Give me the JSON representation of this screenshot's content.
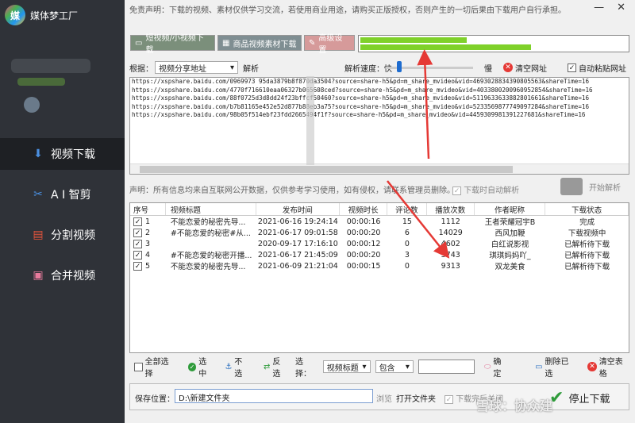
{
  "app": {
    "title": "媒体梦工厂",
    "logo_text": "媒"
  },
  "sidebar": {
    "items": [
      {
        "label": "视频下载",
        "icon": "download-icon"
      },
      {
        "label": "A I 智剪",
        "icon": "ai-icon"
      },
      {
        "label": "分割视频",
        "icon": "split-icon"
      },
      {
        "label": "合并视频",
        "icon": "merge-icon"
      }
    ]
  },
  "window": {
    "min": "—",
    "close": "✕"
  },
  "notice": "免责声明：下载的视频、素材仅供学习交流，若使用商业用途，请购买正版授权，否则产生的一切后果由下载用户自行承担。",
  "toolbar": {
    "btn1": "短视频/小视频下载",
    "btn2": "商品视频素材下载",
    "btn3": "高级设置",
    "progress": [
      0.4,
      0.64
    ]
  },
  "controls": {
    "by_label": "根据：",
    "by_value": "视频分享地址",
    "parse_label": "解析",
    "speed_label": "解析速度：",
    "fast": "快",
    "slow": "慢",
    "clear_url": "清空网址",
    "auto_paste": "自动粘贴网址"
  },
  "urls": [
    "https://xspshare.baidu.com/0969973 95da3879b8f870da3504?source=share-h5&pd=m_share_mvideo&vid=4693028834390805563&shareTime=16",
    "https://xspshare.baidu.com/4770f716610eaa06327b065608ced?source=share-h5&pd=m_share_mvideo&vid=4033800200960952854&shareTime=16",
    "https://xspshare.baidu.com/88f0725d3d8dd24f23bffcf50460?source=share-h5&pd=m_share_mvideo&vid=5119633633882801661&shareTime=16",
    "https://xspshare.baidu.com/b7b81165e452e52d877b88eb3a75?source=share-h5&pd=m_share_mvideo&vid=5233569877749097284&shareTime=16",
    "https://xspshare.baidu.com/98b05f514ebf23fdd2665494f1f?source=share-h5&pd=m_share_mvideo&vid=4459309981391227681&shareTime=16"
  ],
  "notice2": "声明：所有信息均来自互联网公开数据，仅供参考学习使用，如有侵权，请联系管理员删除。",
  "auto_parse": "下载时自动解析",
  "start_parse": "开始解析",
  "table": {
    "headers": [
      "序号",
      "视频标题",
      "发布时间",
      "视频时长",
      "评论数",
      "播放次数",
      "作者昵称",
      "下载状态"
    ],
    "rows": [
      [
        "1",
        "不能恋爱的秘密先导...",
        "2021-06-16 19:24:14",
        "00:00:16",
        "15",
        "1112",
        "王者荣耀冠宇B",
        "完成"
      ],
      [
        "2",
        "#不能恋爱的秘密#从...",
        "2021-06-17 09:01:58",
        "00:00:20",
        "6",
        "14029",
        "西风加鞭",
        "下载视频中"
      ],
      [
        "3",
        "",
        "2020-09-17 17:16:10",
        "00:00:12",
        "0",
        "4602",
        "白红说影视",
        "已解析待下载"
      ],
      [
        "4",
        "#不能恋爱的秘密开播...",
        "2021-06-17 21:45:09",
        "00:00:20",
        "3",
        "3743",
        "琪琪妈妈吖_",
        "已解析待下载"
      ],
      [
        "5",
        "不能恋爱的秘密先导...",
        "2021-06-09 21:21:04",
        "00:00:15",
        "0",
        "9313",
        "双龙美食",
        "已解析待下载"
      ]
    ]
  },
  "bottom": {
    "select_all": "全部选择",
    "select": "选中",
    "unselect": "不选",
    "invert": "反选",
    "choose_label": "选择：",
    "field": "视频标题",
    "match": "包含",
    "confirm": "确定",
    "delete_selected": "删除已选",
    "clear_table": "清空表格"
  },
  "save": {
    "label": "保存位置：",
    "path": "D:\\新建文件夹",
    "browse": "浏览",
    "open": "打开文件夹",
    "close_after": "下载完后关闭",
    "stop": "停止下载"
  },
  "watermark": "雪球：协众建"
}
